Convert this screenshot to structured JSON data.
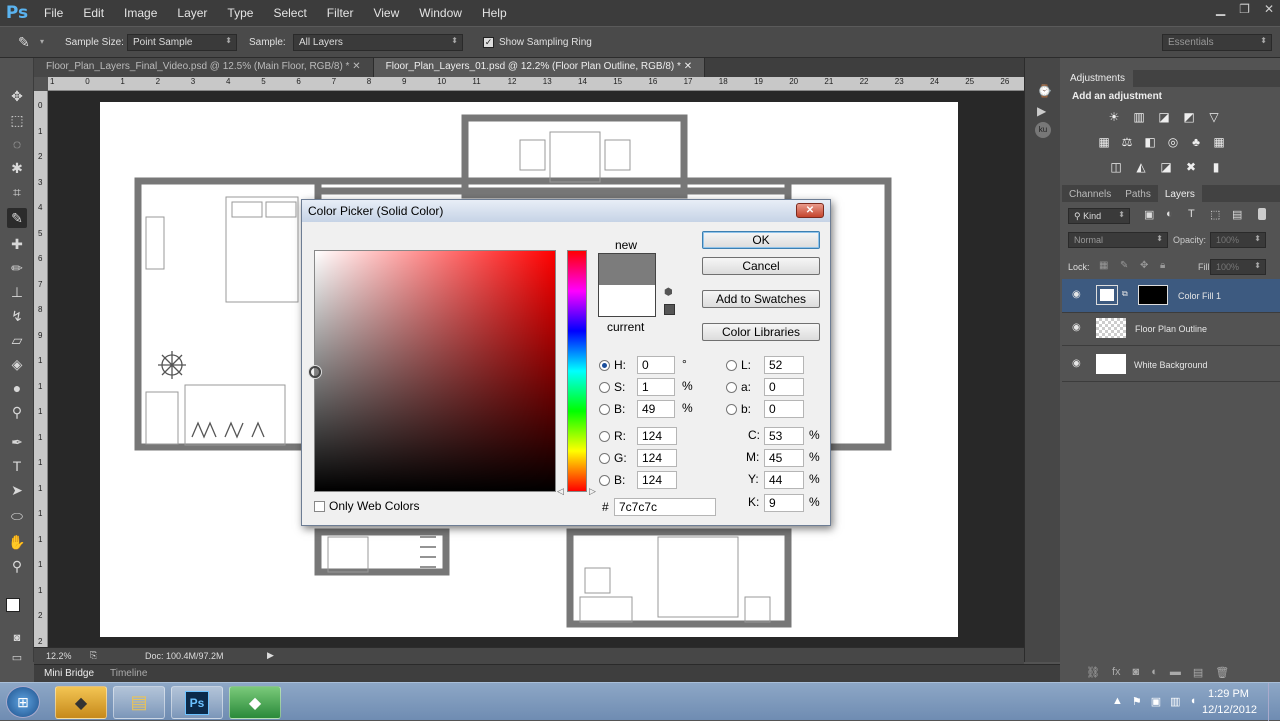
{
  "app": {
    "logo": "Ps",
    "menu": [
      "File",
      "Edit",
      "Image",
      "Layer",
      "Type",
      "Select",
      "Filter",
      "View",
      "Window",
      "Help"
    ],
    "window_controls": [
      "minimize-icon",
      "restore-icon",
      "close-icon"
    ]
  },
  "options": {
    "sample_size_label": "Sample Size:",
    "sample_size_value": "Point Sample",
    "sample_label": "Sample:",
    "sample_value": "All Layers",
    "show_ring_label": "Show Sampling Ring",
    "show_ring_checked": true,
    "workspace": "Essentials"
  },
  "tabs": [
    {
      "label": "Floor_Plan_Layers_Final_Video.psd @ 12.5% (Main Floor, RGB/8) *",
      "active": false
    },
    {
      "label": "Floor_Plan_Layers_01.psd @ 12.2% (Floor Plan Outline, RGB/8) *",
      "active": true
    }
  ],
  "rulers": {
    "h": [
      "1",
      "0",
      "1",
      "2",
      "3",
      "4",
      "5",
      "6",
      "7",
      "8",
      "9",
      "10",
      "11",
      "12",
      "13",
      "14",
      "15",
      "16",
      "17",
      "18",
      "19",
      "20",
      "21",
      "22",
      "23",
      "24",
      "25",
      "26"
    ],
    "v": [
      "0",
      "1",
      "2",
      "3",
      "4",
      "5",
      "6",
      "7",
      "8",
      "9",
      "1",
      "1",
      "1",
      "1",
      "1",
      "1",
      "1",
      "1",
      "1",
      "1",
      "2",
      "2"
    ]
  },
  "status": {
    "zoom": "12.2%",
    "doc": "Doc: 100.4M/97.2M"
  },
  "bottom_tabs": [
    "Mini Bridge",
    "Timeline"
  ],
  "adjustments": {
    "tab": "Adjustments",
    "hint": "Add an adjustment"
  },
  "layers_panel": {
    "tabs": [
      "Channels",
      "Paths",
      "Layers"
    ],
    "filter": "Kind",
    "blend_mode": "Normal",
    "opacity_label": "Opacity:",
    "opacity_value": "100%",
    "lock_label": "Lock:",
    "fill_label": "Fill:",
    "fill_value": "100%",
    "layers": [
      "Color Fill 1",
      "Floor Plan Outline",
      "White Background"
    ]
  },
  "dialog": {
    "title": "Color Picker (Solid Color)",
    "new_label": "new",
    "current_label": "current",
    "new_color": "#7c7c7c",
    "current_color": "#ffffff",
    "ok": "OK",
    "cancel": "Cancel",
    "add_swatches": "Add to Swatches",
    "color_libraries": "Color Libraries",
    "H": "0",
    "H_unit": "°",
    "S": "1",
    "S_unit": "%",
    "Bv": "49",
    "Bv_unit": "%",
    "R": "124",
    "G": "124",
    "B": "124",
    "L": "52",
    "a": "0",
    "b": "0",
    "C": "53",
    "M": "45",
    "Y": "44",
    "K": "9",
    "hex_label": "#",
    "hex": "7c7c7c",
    "web_only": "Only Web Colors",
    "labels": {
      "H": "H:",
      "S": "S:",
      "Bv": "B:",
      "R": "R:",
      "G": "G:",
      "B": "B:",
      "L": "L:",
      "a": "a:",
      "b": "b:",
      "C": "C:",
      "M": "M:",
      "Y": "Y:",
      "K": "K:",
      "pct": "%"
    }
  },
  "taskbar": {
    "time": "1:29 PM",
    "date": "12/12/2012"
  }
}
